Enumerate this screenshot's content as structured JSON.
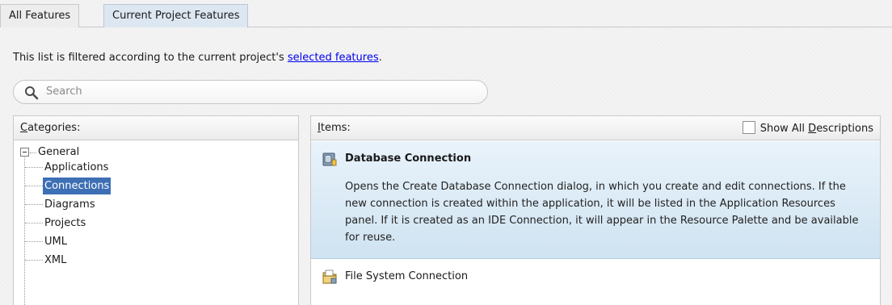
{
  "tabs": [
    {
      "label": "All Features"
    },
    {
      "label": "Current Project Features",
      "selected": true
    }
  ],
  "filter_note": {
    "prefix": "This list is filtered according to the current project's ",
    "link": "selected features",
    "suffix": "."
  },
  "search": {
    "placeholder": "Search"
  },
  "categories": {
    "header_key": "C",
    "header_rest": "ategories:",
    "root": {
      "label": "General",
      "expanded": true
    },
    "children": [
      {
        "label": "Applications"
      },
      {
        "label": "Connections",
        "selected": true
      },
      {
        "label": "Diagrams"
      },
      {
        "label": "Projects"
      },
      {
        "label": "UML"
      },
      {
        "label": "XML"
      }
    ]
  },
  "items": {
    "header_key": "I",
    "header_rest": "tems:",
    "show_all": {
      "pre": "Show All ",
      "key": "D",
      "post": "escriptions",
      "checked": false
    },
    "list": [
      {
        "title": "Database Connection",
        "icon": "database-connection-icon",
        "selected": true,
        "description": "Opens the Create Database Connection dialog, in which you create and edit connections. If the new connection is created within the application, it will be listed in the Application Resources panel. If it is created as an IDE Connection, it will appear in the Resource Palette and be available for reuse."
      },
      {
        "title": "File System Connection",
        "icon": "file-system-connection-icon",
        "selected": false
      }
    ]
  },
  "colors": {
    "selection": "#3d6fb4",
    "item_highlight": "#dbeaf6",
    "link": "#0000ee"
  }
}
